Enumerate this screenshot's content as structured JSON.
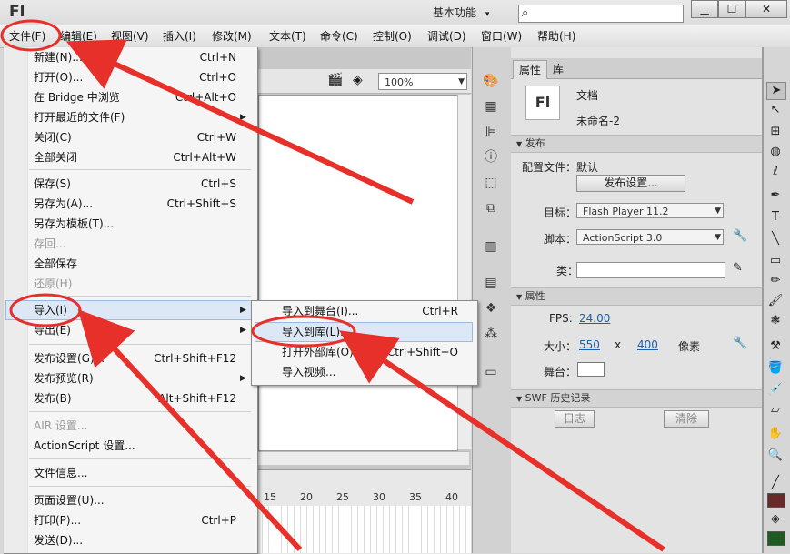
{
  "titlebar": {
    "logo": "Fl",
    "workspace_label": "基本功能",
    "workspace_arrow": "▾",
    "search_icon": "⌕",
    "minimize": "▁",
    "maximize": "☐",
    "close": "✕"
  },
  "menubar": {
    "items": [
      "文件(F)",
      "编辑(E)",
      "视图(V)",
      "插入(I)",
      "修改(M)",
      "文本(T)",
      "命令(C)",
      "控制(O)",
      "调试(D)",
      "窗口(W)",
      "帮助(H)"
    ]
  },
  "doc_toolbar": {
    "zoom": "100%"
  },
  "timeline": {
    "ticks": [
      "15",
      "20",
      "25",
      "30",
      "35",
      "40"
    ]
  },
  "file_menu": {
    "items": [
      {
        "label": "新建(N)...",
        "shortcut": "Ctrl+N"
      },
      {
        "label": "打开(O)...",
        "shortcut": "Ctrl+O"
      },
      {
        "label": "在 Bridge 中浏览",
        "shortcut": "Ctrl+Alt+O"
      },
      {
        "label": "打开最近的文件(F)",
        "shortcut": "",
        "submenu": true
      },
      {
        "label": "关闭(C)",
        "shortcut": "Ctrl+W"
      },
      {
        "label": "全部关闭",
        "shortcut": "Ctrl+Alt+W"
      },
      {
        "label": "保存(S)",
        "shortcut": "Ctrl+S"
      },
      {
        "label": "另存为(A)...",
        "shortcut": "Ctrl+Shift+S"
      },
      {
        "label": "另存为模板(T)...",
        "shortcut": ""
      },
      {
        "label": "存回...",
        "shortcut": "",
        "disabled": true
      },
      {
        "label": "全部保存",
        "shortcut": ""
      },
      {
        "label": "还原(H)",
        "shortcut": "",
        "disabled": true
      },
      {
        "label": "导入(I)",
        "shortcut": "",
        "submenu": true,
        "highlighted": true
      },
      {
        "label": "导出(E)",
        "shortcut": "",
        "submenu": true
      },
      {
        "label": "发布设置(G)...",
        "shortcut": "Ctrl+Shift+F12"
      },
      {
        "label": "发布预览(R)",
        "shortcut": "",
        "submenu": true
      },
      {
        "label": "发布(B)",
        "shortcut": "Alt+Shift+F12"
      },
      {
        "label": "AIR 设置...",
        "shortcut": "",
        "disabled": true
      },
      {
        "label": "ActionScript 设置...",
        "shortcut": ""
      },
      {
        "label": "文件信息...",
        "shortcut": ""
      },
      {
        "label": "页面设置(U)...",
        "shortcut": ""
      },
      {
        "label": "打印(P)...",
        "shortcut": "Ctrl+P"
      },
      {
        "label": "发送(D)...",
        "shortcut": ""
      }
    ]
  },
  "import_submenu": {
    "items": [
      {
        "label": "导入到舞台(I)...",
        "shortcut": "Ctrl+R"
      },
      {
        "label": "导入到库(L)...",
        "shortcut": "",
        "highlighted": true
      },
      {
        "label": "打开外部库(O)...",
        "shortcut": "Ctrl+Shift+O"
      },
      {
        "label": "导入视频...",
        "shortcut": ""
      }
    ]
  },
  "properties": {
    "tab_properties": "属性",
    "tab_library": "库",
    "doc_icon": "Fl",
    "doc_type": "文档",
    "doc_name": "未命名-2",
    "publish_section": "发布",
    "profile_label": "配置文件：",
    "profile_value": "默认",
    "publish_settings_button": "发布设置...",
    "target_label": "目标：",
    "target_value": "Flash Player 11.2",
    "script_label": "脚本：",
    "script_value": "ActionScript 3.0",
    "class_label": "类：",
    "class_value": "",
    "props_section": "属性",
    "fps_label": "FPS:",
    "fps_value": "24.00",
    "size_label": "大小：",
    "width_value": "550",
    "size_x": "x",
    "height_value": "400",
    "unit": "像素",
    "stage_label": "舞台：",
    "stage_color": "#ffffff",
    "swf_section": "SWF 历史记录",
    "log_button": "日志",
    "clear_button": "清除"
  },
  "colors": {
    "annotation_red": "#e8302a",
    "stroke_color": "#6b2a2a",
    "fill_color": "#1f5a1f"
  }
}
